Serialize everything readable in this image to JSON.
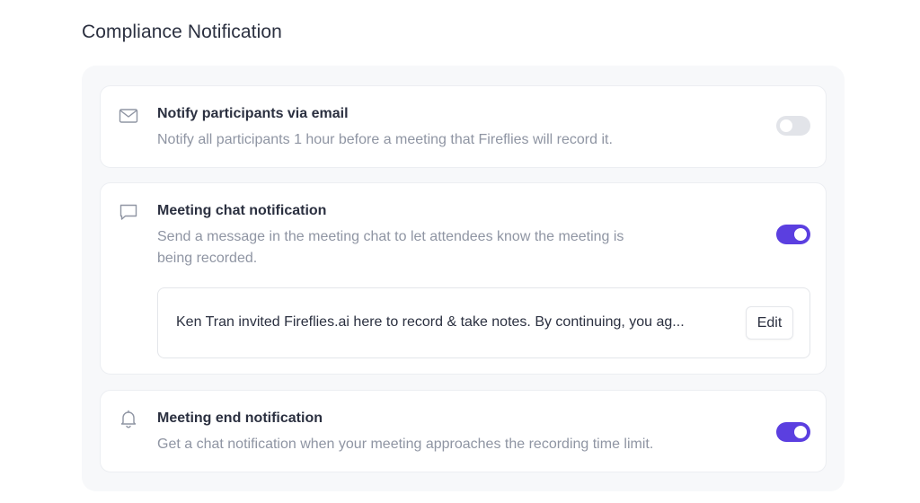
{
  "page": {
    "title": "Compliance Notification"
  },
  "settings": [
    {
      "icon": "envelope-icon",
      "title": "Notify participants via email",
      "description": "Notify all participants 1 hour before a meeting that Fireflies will record it.",
      "enabled": false
    },
    {
      "icon": "chat-bubble-icon",
      "title": "Meeting chat notification",
      "description_line1": "Send a message in the meeting chat to let attendees know the meeting is",
      "description_line2": "being recorded.",
      "enabled": true,
      "message": "Ken Tran invited Fireflies.ai here to record & take notes. By continuing, you ag...",
      "edit_label": "Edit"
    },
    {
      "icon": "bell-icon",
      "title": "Meeting end notification",
      "description": "Get a chat notification when your meeting approaches the recording time limit.",
      "enabled": true
    }
  ],
  "colors": {
    "toggle_on": "#5b3fe0",
    "toggle_off": "#e2e4e9",
    "muted_text": "#8f95a3",
    "panel_background": "#f7f8fa"
  }
}
